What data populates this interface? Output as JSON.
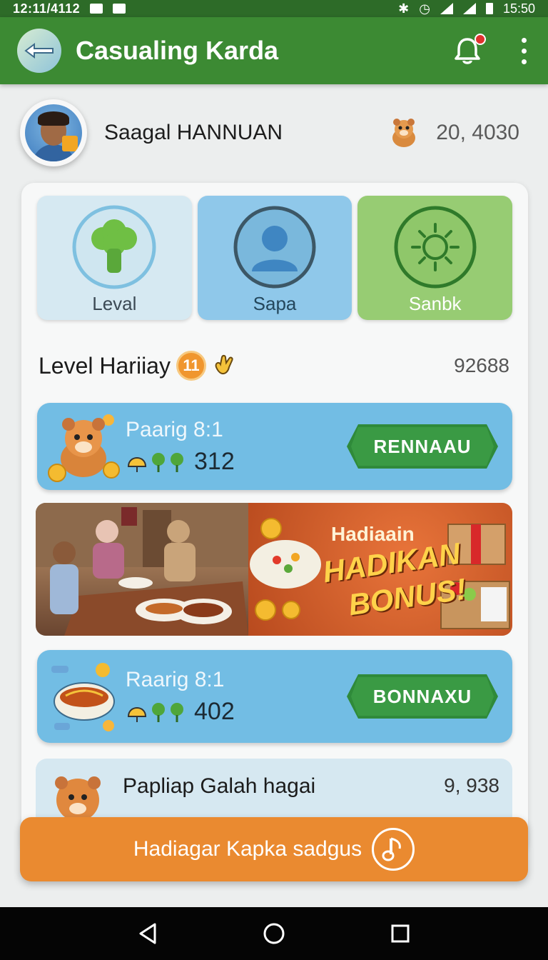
{
  "status_bar": {
    "time_left": "12:11/4112",
    "time_right": "15:50"
  },
  "app_bar": {
    "title": "Casualing Karda",
    "icons": [
      "back-logo-icon",
      "bell-icon",
      "more-vert-icon"
    ],
    "accent": "#3c8a33"
  },
  "profile": {
    "name": "Saagal HANNUAN",
    "coins": "20, 4030"
  },
  "tiles": [
    {
      "label": "Leval",
      "icon": "broccoli-icon"
    },
    {
      "label": "Sapa",
      "icon": "person-icon"
    },
    {
      "label": "Sanbk",
      "icon": "sun-icon"
    }
  ],
  "level": {
    "title": "Level Hariiay",
    "badge": "11",
    "score": "92688"
  },
  "rewards": [
    {
      "title": "Paarig 8:1",
      "count": "312",
      "button": "RENNAAU"
    },
    {
      "title": "Raarig 8:1",
      "count": "402",
      "button": "BONNAXU"
    }
  ],
  "banner": {
    "small": "Hadiaain",
    "big1": "HADIKAN",
    "big2": "BONUS!"
  },
  "list_item": {
    "title": "Papliap Galah hagai",
    "value": "9, 938"
  },
  "cta": {
    "label": "Hadiagar Kapka sadgus",
    "icon": "music-note-icon",
    "color": "#ea8a30"
  }
}
